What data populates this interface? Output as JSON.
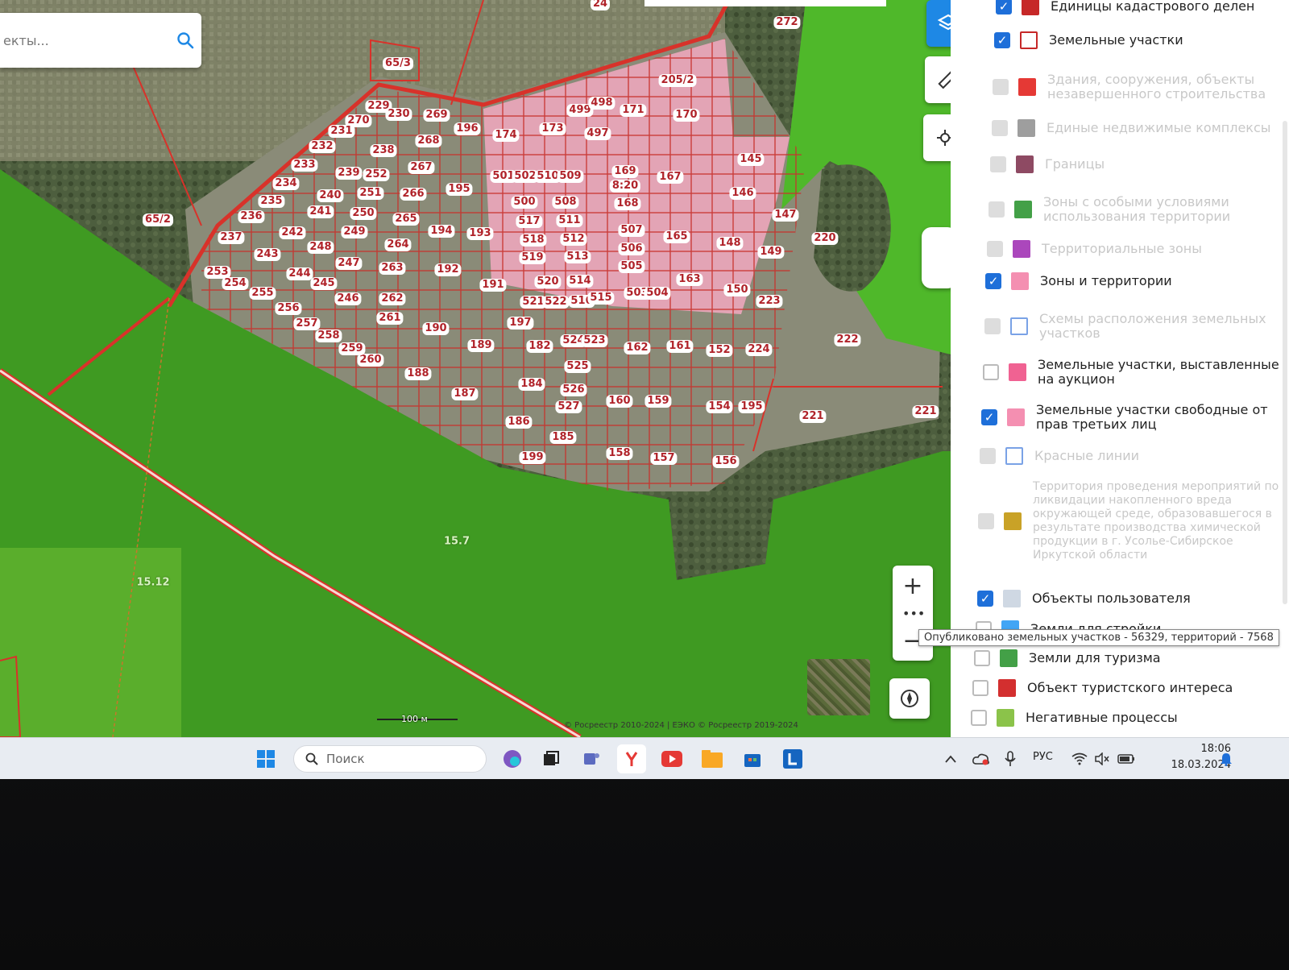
{
  "search": {
    "placeholder": "екты..."
  },
  "map": {
    "scale_label": "100 м",
    "copyright": "© Росреестр 2010-2024 | ЕЭКО © Росреестр 2019-2024",
    "zone_labels": [
      "15.7",
      "15.12"
    ],
    "plot_numbers": [
      "24",
      "272",
      "65/3",
      "205/2",
      "269",
      "229",
      "230",
      "196",
      "174",
      "173",
      "499",
      "498",
      "171",
      "170",
      "497",
      "270",
      "231",
      "268",
      "238",
      "232",
      "267",
      "195",
      "501",
      "502",
      "510",
      "509",
      "169",
      "8:20",
      "167",
      "145",
      "146",
      "233",
      "239",
      "252",
      "251",
      "266",
      "500",
      "508",
      "168",
      "234",
      "240",
      "250",
      "241",
      "265",
      "194",
      "193",
      "517",
      "511",
      "507",
      "165",
      "147",
      "220",
      "65/2",
      "235",
      "249",
      "242",
      "236",
      "248",
      "264",
      "518",
      "512",
      "506",
      "148",
      "149",
      "237",
      "243",
      "247",
      "263",
      "192",
      "191",
      "519",
      "513",
      "505",
      "163",
      "150",
      "223",
      "253",
      "254",
      "255",
      "256",
      "244",
      "245",
      "246",
      "262",
      "261",
      "520",
      "514",
      "521",
      "522",
      "516",
      "515",
      "503",
      "504",
      "222",
      "190",
      "197",
      "189",
      "182",
      "524",
      "523",
      "162",
      "161",
      "152",
      "224",
      "260",
      "259",
      "258",
      "257",
      "188",
      "187",
      "184",
      "525",
      "526",
      "160",
      "159",
      "154",
      "195",
      "221",
      "186",
      "527",
      "185",
      "158",
      "157",
      "156",
      "199",
      "221"
    ],
    "colors": {
      "accent": "#1e88e5",
      "boundary": "#d8322a",
      "zone_fill": "#f2a8c0",
      "green_zone": "#4aa324"
    }
  },
  "layers_panel": {
    "items": [
      {
        "label": "Единицы кадастрового делен",
        "checked": true,
        "dim": false,
        "swatch": "#c62828"
      },
      {
        "label": "Земельные участки",
        "checked": true,
        "dim": false,
        "swatch": "#ffffff"
      },
      {
        "label": "Здания, сооружения, объекты незавершенного строительства",
        "checked": false,
        "dim": true,
        "swatch": "#e53935"
      },
      {
        "label": "Единые недвижимые комплексы",
        "checked": false,
        "dim": true,
        "swatch": "#9e9e9e"
      },
      {
        "label": "Границы",
        "checked": false,
        "dim": true,
        "swatch": "#8e4a63"
      },
      {
        "label": "Зоны с особыми условиями использования территории",
        "checked": false,
        "dim": true,
        "swatch": "#43a047"
      },
      {
        "label": "Территориальные зоны",
        "checked": false,
        "dim": true,
        "swatch": "#ab47bc"
      },
      {
        "label": "Зоны и территории",
        "checked": true,
        "dim": false,
        "swatch": "#f48fb1"
      },
      {
        "label": "Схемы расположения земельных участков",
        "checked": false,
        "dim": true,
        "swatch": "#ffffff"
      },
      {
        "label": "Земельные участки, выставленные на аукцион",
        "checked": false,
        "dim": false,
        "swatch": "#f06292"
      },
      {
        "label": "Земельные участки свободные от прав третьих лиц",
        "checked": true,
        "dim": false,
        "swatch": "#f48fb1"
      },
      {
        "label": "Красные линии",
        "checked": false,
        "dim": true,
        "swatch": "#ffffff"
      },
      {
        "label": "Территория проведения мероприятий по ликвидации накопленного вреда окружающей среде, образовавшегося в результате производства химической продукции в г. Усолье-Сибирское Иркутской области",
        "checked": false,
        "dim": true,
        "swatch": "#c9a227"
      },
      {
        "label": "Объекты пользователя",
        "checked": true,
        "dim": false,
        "swatch": "#cfd8e3"
      },
      {
        "label": "Земли для стройки",
        "checked": false,
        "dim": false,
        "swatch": "#42a5f5"
      },
      {
        "label": "Земли для туризма",
        "checked": false,
        "dim": false,
        "swatch": "#43a047"
      },
      {
        "label": "Объект туристского интереса",
        "checked": false,
        "dim": false,
        "swatch": "#d32f2f"
      },
      {
        "label": "Негативные процессы",
        "checked": false,
        "dim": false,
        "swatch": "#8bc34a"
      }
    ],
    "tooltip": "Опубликовано земельных участков - 56329, территорий - 7568"
  },
  "taskbar": {
    "search_placeholder": "Поиск",
    "language": "РУС",
    "time": "18:06",
    "date": "18.03.2024"
  }
}
